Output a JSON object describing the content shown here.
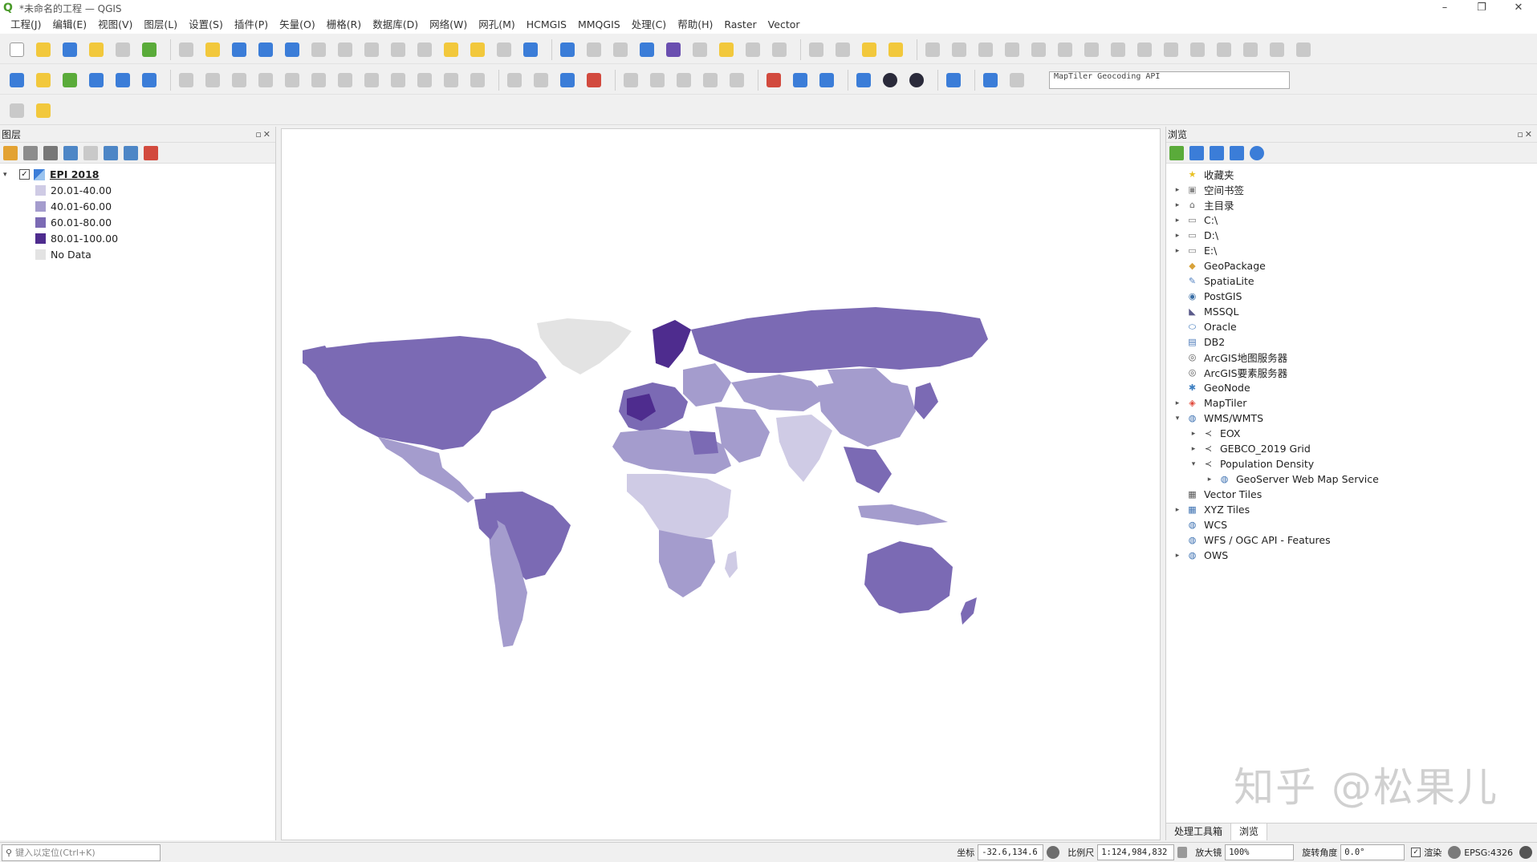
{
  "window": {
    "title": "*未命名的工程 — QGIS",
    "controls": [
      "–",
      "❐",
      "✕"
    ]
  },
  "menubar": {
    "items": [
      "工程(J)",
      "编辑(E)",
      "视图(V)",
      "图层(L)",
      "设置(S)",
      "插件(P)",
      "矢量(O)",
      "栅格(R)",
      "数据库(D)",
      "网络(W)",
      "网孔(M)",
      "HCMGIS",
      "MMQGIS",
      "处理(C)",
      "帮助(H)",
      "Raster",
      "Vector"
    ]
  },
  "toolbar": {
    "geocoder_placeholder": "MapTiler Geocoding API"
  },
  "layers_panel": {
    "title": "图层",
    "close_glyph": "▫✕",
    "layer_name": "EPI 2018",
    "check_glyph": "✓",
    "expand_glyph": "▾",
    "legend": [
      {
        "label": "20.01-40.00",
        "color": "#cfcbe5"
      },
      {
        "label": "40.01-60.00",
        "color": "#a49ccd"
      },
      {
        "label": "60.01-80.00",
        "color": "#7b6ab4"
      },
      {
        "label": "80.01-100.00",
        "color": "#4e2c8e"
      },
      {
        "label": "No Data",
        "color": "#e3e3e3"
      }
    ]
  },
  "browser_panel": {
    "title": "浏览",
    "close_glyph": "▫✕",
    "items": [
      {
        "label": "收藏夹",
        "icon": "star-icon",
        "glyph": "★",
        "color": "#e8c023",
        "arrow": ""
      },
      {
        "label": "空间书签",
        "icon": "bookmark-icon",
        "glyph": "▣",
        "color": "#8a8a8a",
        "arrow": "▸"
      },
      {
        "label": "主目录",
        "icon": "home-icon",
        "glyph": "⌂",
        "color": "#666666",
        "arrow": "▸"
      },
      {
        "label": "C:\\",
        "icon": "folder-icon",
        "glyph": "▭",
        "color": "#777777",
        "arrow": "▸"
      },
      {
        "label": "D:\\",
        "icon": "folder-icon",
        "glyph": "▭",
        "color": "#777777",
        "arrow": "▸"
      },
      {
        "label": "E:\\",
        "icon": "folder-icon",
        "glyph": "▭",
        "color": "#777777",
        "arrow": "▸"
      },
      {
        "label": "GeoPackage",
        "icon": "geopackage-icon",
        "glyph": "◆",
        "color": "#d8a23a",
        "arrow": ""
      },
      {
        "label": "SpatiaLite",
        "icon": "spatialite-icon",
        "glyph": "✎",
        "color": "#4f7fbf",
        "arrow": ""
      },
      {
        "label": "PostGIS",
        "icon": "postgis-icon",
        "glyph": "◉",
        "color": "#3a6ea5",
        "arrow": ""
      },
      {
        "label": "MSSQL",
        "icon": "mssql-icon",
        "glyph": "◣",
        "color": "#5a5a8a",
        "arrow": ""
      },
      {
        "label": "Oracle",
        "icon": "oracle-icon",
        "glyph": "⬭",
        "color": "#2f6db5",
        "arrow": ""
      },
      {
        "label": "DB2",
        "icon": "db2-icon",
        "glyph": "▤",
        "color": "#4a78b8",
        "arrow": ""
      },
      {
        "label": "ArcGIS地图服务器",
        "icon": "arcgis-map-icon",
        "glyph": "◎",
        "color": "#555555",
        "arrow": ""
      },
      {
        "label": "ArcGIS要素服务器",
        "icon": "arcgis-feature-icon",
        "glyph": "◎",
        "color": "#555555",
        "arrow": ""
      },
      {
        "label": "GeoNode",
        "icon": "geonode-icon",
        "glyph": "✱",
        "color": "#3d7fc1",
        "arrow": ""
      },
      {
        "label": "MapTiler",
        "icon": "maptiler-icon",
        "glyph": "◈",
        "color": "#e0483a",
        "arrow": "▸"
      },
      {
        "label": "WMS/WMTS",
        "icon": "wms-icon",
        "glyph": "◍",
        "color": "#3a6fb0",
        "arrow": "▾"
      },
      {
        "label": "EOX",
        "icon": "connection-icon",
        "glyph": "≺",
        "color": "#444444",
        "arrow": "▸",
        "indent": 1
      },
      {
        "label": "GEBCO_2019 Grid",
        "icon": "connection-icon",
        "glyph": "≺",
        "color": "#444444",
        "arrow": "▸",
        "indent": 1
      },
      {
        "label": "Population Density",
        "icon": "connection-icon",
        "glyph": "≺",
        "color": "#444444",
        "arrow": "▾",
        "indent": 1
      },
      {
        "label": "GeoServer Web Map Service",
        "icon": "globe-icon",
        "glyph": "◍",
        "color": "#3a6fb0",
        "arrow": "▸",
        "indent": 2
      },
      {
        "label": "Vector Tiles",
        "icon": "vector-tiles-icon",
        "glyph": "▦",
        "color": "#555555",
        "arrow": ""
      },
      {
        "label": "XYZ Tiles",
        "icon": "xyz-tiles-icon",
        "glyph": "▦",
        "color": "#3a6fb0",
        "arrow": "▸"
      },
      {
        "label": "WCS",
        "icon": "wcs-icon",
        "glyph": "◍",
        "color": "#3a6fb0",
        "arrow": ""
      },
      {
        "label": "WFS / OGC API - Features",
        "icon": "wfs-icon",
        "glyph": "◍",
        "color": "#3a6fb0",
        "arrow": ""
      },
      {
        "label": "OWS",
        "icon": "ows-icon",
        "glyph": "◍",
        "color": "#3a6fb0",
        "arrow": "▸"
      }
    ],
    "bottom_tabs": [
      "处理工具箱",
      "浏览"
    ],
    "watermark": "知乎 @松果儿"
  },
  "statusbar": {
    "locator_glyph": "⚲",
    "locator_placeholder": "键入以定位(Ctrl+K)",
    "coord_label": "坐标",
    "coord_value": "-32.6,134.6",
    "scale_label": "比例尺",
    "scale_value": "1:124,984,832",
    "magnifier_label": "放大镜",
    "magnifier_value": "100%",
    "rotation_label": "旋转角度",
    "rotation_value": "0.0°",
    "check_glyph": "✓",
    "render_label": "渲染",
    "crs": "EPSG:4326"
  }
}
